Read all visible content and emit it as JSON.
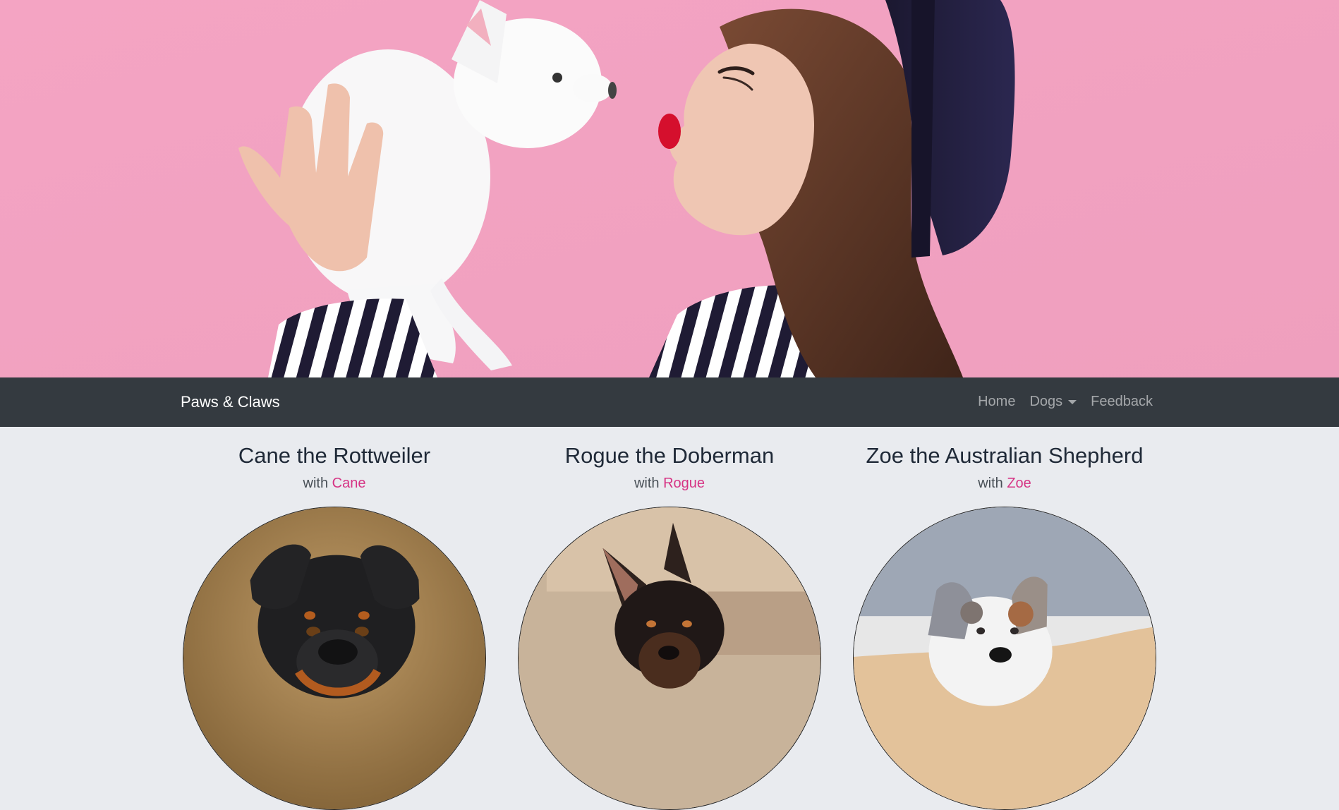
{
  "site": {
    "brand": "Paws & Claws"
  },
  "nav": {
    "items": [
      {
        "label": "Home",
        "dropdown": false
      },
      {
        "label": "Dogs",
        "dropdown": true
      },
      {
        "label": "Feedback",
        "dropdown": false
      }
    ]
  },
  "hero": {
    "image": "woman kissing white puppy on pink background"
  },
  "cards": [
    {
      "title": "Cane the Rottweiler",
      "subtitle_prefix": "with",
      "owner": "Cane",
      "image": "rottweiler portrait"
    },
    {
      "title": "Rogue the Doberman",
      "subtitle_prefix": "with",
      "owner": "Rogue",
      "image": "doberman portrait"
    },
    {
      "title": "Zoe the Australian Shepherd",
      "subtitle_prefix": "with",
      "owner": "Zoe",
      "image": "australian shepherd portrait"
    }
  ],
  "colors": {
    "hero_pink": "#f3a3c3",
    "nav_bg": "#343a40",
    "nav_text": "#ffffff",
    "nav_link": "#bfc5cc",
    "page_bg": "#e9ebef",
    "owner_link": "#d63384"
  }
}
